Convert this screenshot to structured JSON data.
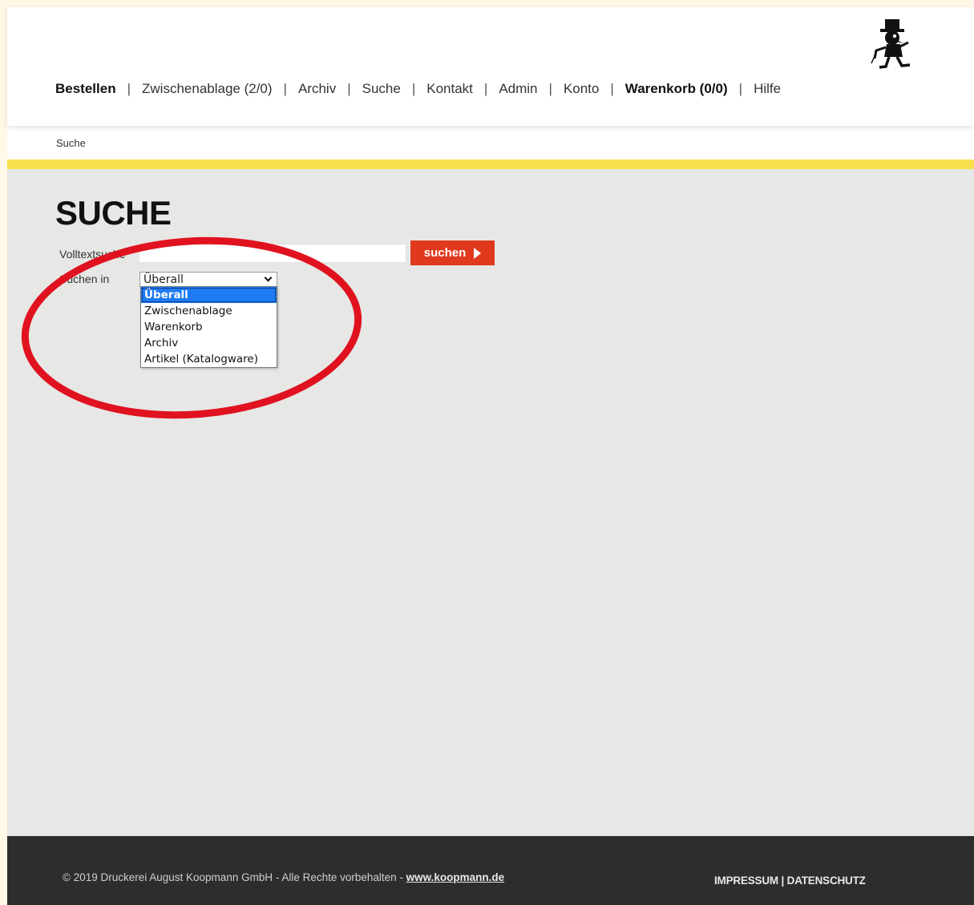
{
  "nav": [
    {
      "label": "Bestellen",
      "strong": true
    },
    {
      "label": "Zwischenablage (2/0)",
      "strong": false
    },
    {
      "label": "Archiv",
      "strong": false
    },
    {
      "label": "Suche",
      "strong": false
    },
    {
      "label": "Kontakt",
      "strong": false
    },
    {
      "label": "Admin",
      "strong": false
    },
    {
      "label": "Konto",
      "strong": false
    },
    {
      "label": "Warenkorb (0/0)",
      "strong": true
    },
    {
      "label": "Hilfe",
      "strong": false
    }
  ],
  "nav_separator": "|",
  "breadcrumb": "Suche",
  "page_title": "SUCHE",
  "search": {
    "fulltext_label": "Volltextsuche",
    "fulltext_value": "",
    "button_label": "suchen",
    "scope_label": "Suchen in",
    "scope_selected": "Überall",
    "scope_options": [
      "Überall",
      "Zwischenablage",
      "Warenkorb",
      "Archiv",
      "Artikel (Katalogware)"
    ]
  },
  "annotation_color": "#e0121f",
  "accent_color": "#e0391e",
  "stripe_color": "#f7e04b",
  "footer": {
    "copyright": "© 2019 Druckerei August Koopmann GmbH - Alle Rechte vorbehalten - ",
    "site_link": "www.koopmann.de",
    "impressum": "IMPRESSUM",
    "legal_separator": " | ",
    "datenschutz": "DATENSCHUTZ"
  }
}
